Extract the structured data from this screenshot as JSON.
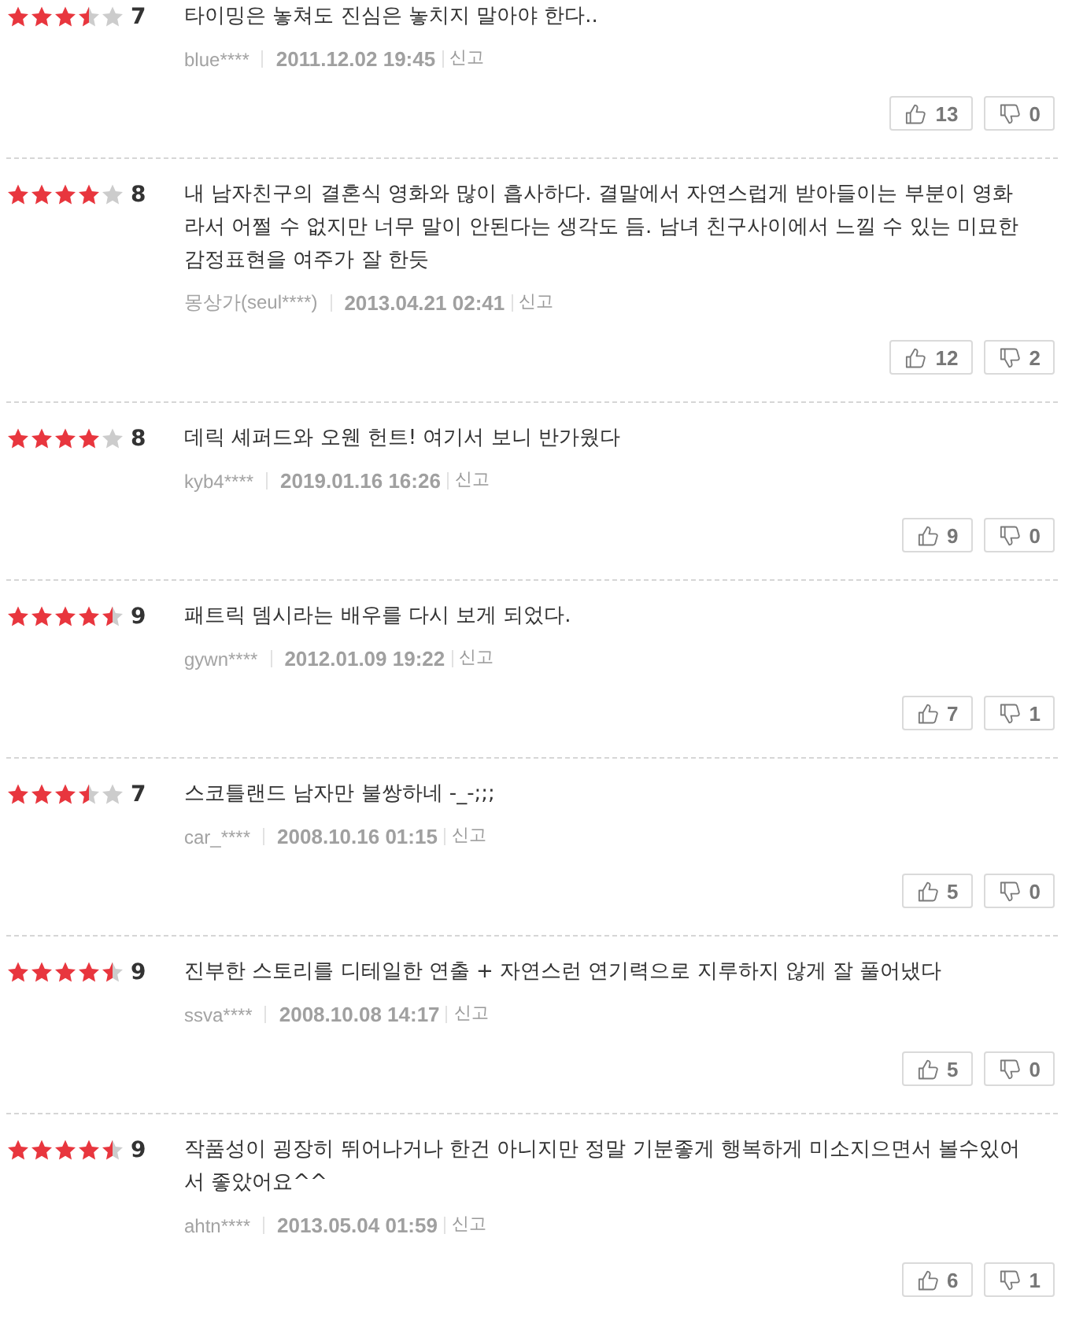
{
  "reviews": [
    {
      "stars": 3.5,
      "score": "7",
      "comment": "타이밍은 놓쳐도 진심은 놓치지 말아야 한다..",
      "user": "blue****",
      "date": "2011.12.02 19:45",
      "report": "신고",
      "likes": "13",
      "dislikes": "0"
    },
    {
      "stars": 4,
      "score": "8",
      "comment": "내 남자친구의 결혼식 영화와 많이 흡사하다. 결말에서 자연스럽게 받아들이는 부분이 영화라서 어쩔 수 없지만 너무 말이 안된다는 생각도 듬. 남녀 친구사이에서 느낄 수 있는 미묘한 감정표현을 여주가 잘 한듯",
      "user": "몽상가(seul****)",
      "date": "2013.04.21 02:41",
      "report": "신고",
      "likes": "12",
      "dislikes": "2"
    },
    {
      "stars": 4,
      "score": "8",
      "comment": "데릭 셰퍼드와 오웬 헌트! 여기서 보니 반가웠다",
      "user": "kyb4****",
      "date": "2019.01.16 16:26",
      "report": "신고",
      "likes": "9",
      "dislikes": "0"
    },
    {
      "stars": 4.5,
      "score": "9",
      "comment": "패트릭 뎀시라는 배우를 다시 보게 되었다.",
      "user": "gywn****",
      "date": "2012.01.09 19:22",
      "report": "신고",
      "likes": "7",
      "dislikes": "1"
    },
    {
      "stars": 3.5,
      "score": "7",
      "comment": "스코틀랜드 남자만 불쌍하네 -_-;;;",
      "user": "car_****",
      "date": "2008.10.16 01:15",
      "report": "신고",
      "likes": "5",
      "dislikes": "0"
    },
    {
      "stars": 4.5,
      "score": "9",
      "comment": "진부한 스토리를 디테일한 연출 + 자연스런 연기력으로 지루하지 않게 잘 풀어냈다",
      "user": "ssva****",
      "date": "2008.10.08 14:17",
      "report": "신고",
      "likes": "5",
      "dislikes": "0"
    },
    {
      "stars": 4.5,
      "score": "9",
      "comment": "작품성이 굉장히 뛰어나거나 한건 아니지만 정말 기분좋게 행복하게 미소지으면서 볼수있어서 좋았어요^^",
      "user": "ahtn****",
      "date": "2013.05.04 01:59",
      "report": "신고",
      "likes": "6",
      "dislikes": "1"
    }
  ]
}
